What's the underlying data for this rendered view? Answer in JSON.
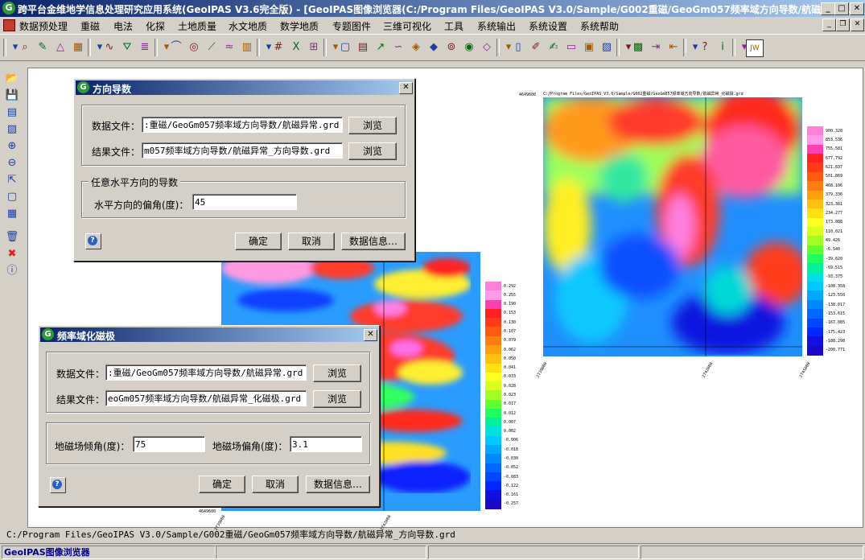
{
  "window": {
    "title": "跨平台金维地学信息处理研究应用系统(GeoIPAS V3.6完全版) - [GeoIPAS图像浏览器(C:/Program Files/GeoIPAS V3.0/Sample/G002重磁/GeoGm057频率域方向导数/航磁异常...",
    "minimize": "_",
    "maximize": "□",
    "close": "✕"
  },
  "menu": [
    "数据预处理",
    "重磁",
    "电法",
    "化探",
    "土地质量",
    "水文地质",
    "数学地质",
    "专题图件",
    "三维可视化",
    "工具",
    "系统输出",
    "系统设置",
    "系统帮助"
  ],
  "toolbar_icons": [
    "dropdown-icon",
    "zoom-in-icon",
    "edit-icon",
    "triangle-icon",
    "grid-icon",
    "dropdown-icon",
    "curve-icon",
    "filter-icon",
    "layers-icon",
    "dropdown-icon",
    "profile-icon",
    "contour-icon",
    "slope-icon",
    "wave-icon",
    "histogram-icon",
    "dropdown-icon",
    "numbers-icon",
    "x-icon",
    "plot-icon",
    "dropdown-icon",
    "frame-icon",
    "table-icon",
    "line-chart-icon",
    "wave2-icon",
    "palette-icon",
    "color-icon",
    "circles-icon",
    "target-icon",
    "color2-icon",
    "dropdown-icon",
    "document-icon",
    "draw-icon",
    "edit2-icon",
    "book-icon",
    "photo-icon",
    "image-icon",
    "dropdown-icon",
    "mosaic-icon",
    "export-icon",
    "import-icon",
    "dropdown-icon",
    "help-icon",
    "info-icon",
    "dropdown-icon",
    "jw-icon"
  ],
  "left_tools": [
    "open-icon",
    "save-icon",
    "print-icon",
    "image-icon",
    "zoom-in-icon",
    "zoom-out-icon",
    "fit-icon",
    "full-extent-icon",
    "tile-icon",
    "delete-icon",
    "close-red-icon",
    "info-icon"
  ],
  "plot_large": {
    "title": "C:/Program Files/GeoIPAS V3.0/Sample/G002重磁/GeoGm057频率域方向导数/航磁异常_化磁极.grd",
    "y_label": "4649600",
    "legend": [
      "900.328",
      "853.536",
      "755.581",
      "677.792",
      "621.837",
      "501.869",
      "468.106",
      "379.336",
      "323.381",
      "234.277",
      "173.888",
      "110.021",
      "49.426",
      "-6.540",
      "-39.620",
      "-69.515",
      "-93.375",
      "-108.358",
      "-123.550",
      "-138.017",
      "-153.615",
      "-167.085",
      "-175.423",
      "-188.298",
      "-200.771"
    ],
    "x_labels": [
      "2739000",
      "2742000",
      "2745000"
    ]
  },
  "plot_small": {
    "y_label": "4649600",
    "legend": [
      "0.292",
      "0.255",
      "0.190",
      "0.153",
      "0.130",
      "0.107",
      "0.079",
      "0.062",
      "0.050",
      "0.041",
      "0.033",
      "0.028",
      "0.023",
      "0.017",
      "0.012",
      "0.007",
      "0.002",
      "-0.006",
      "-0.018",
      "-0.030",
      "-0.052",
      "-0.083",
      "-0.122",
      "-0.161",
      "-0.257"
    ],
    "x_labels": [
      "2739000",
      "2742000"
    ]
  },
  "dialog1": {
    "title": "方向导数",
    "data_file_label": "数据文件：",
    "data_file_value": ":重磁/GeoGm057频率域方向导数/航磁异常.grd",
    "result_file_label": "结果文件：",
    "result_file_value": "m057频率域方向导数/航磁异常_方向导数.grd",
    "browse": "浏览",
    "group_title": "任意水平方向的导数",
    "angle_label": "水平方向的偏角(度)：",
    "angle_value": "45",
    "ok": "确定",
    "cancel": "取消",
    "info": "数据信息…",
    "close": "✕"
  },
  "dialog2": {
    "title": "频率域化磁极",
    "data_file_label": "数据文件：",
    "data_file_value": ":重磁/GeoGm057频率域方向导数/航磁异常.grd",
    "result_file_label": "结果文件：",
    "result_file_value": "eoGm057频率域方向导数/航磁异常_化磁极.grd",
    "browse": "浏览",
    "incl_label": "地磁场倾角(度)：",
    "incl_value": "75",
    "decl_label": "地磁场偏角(度)：",
    "decl_value": "3.1",
    "ok": "确定",
    "cancel": "取消",
    "info": "数据信息…",
    "close": "✕"
  },
  "status_path": "C:/Program Files/GeoIPAS V3.0/Sample/G002重磁/GeoGm057频率域方向导数/航磁异常_方向导数.grd",
  "status_bar": "GeoIPAS图像浏览器"
}
